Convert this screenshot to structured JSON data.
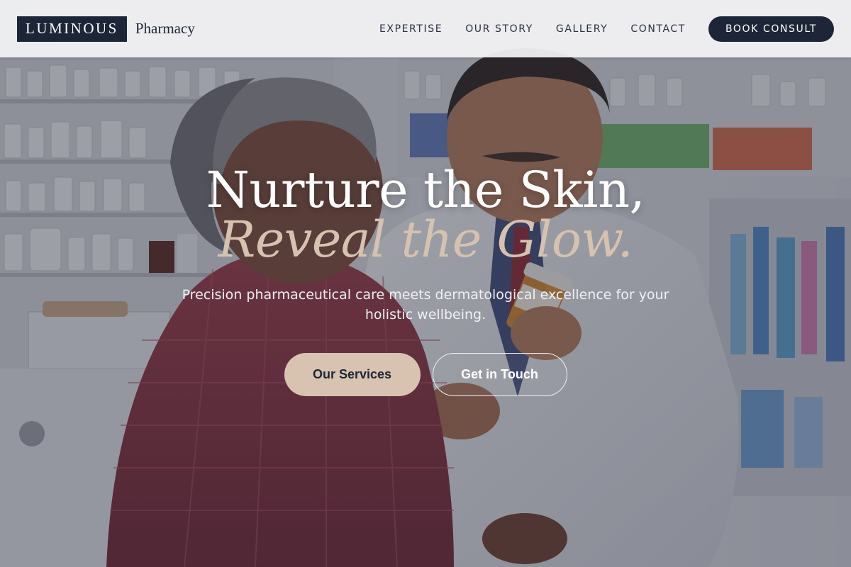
{
  "brand": {
    "logo_text": "LUMINOUS",
    "logo_sub": "Pharmacy"
  },
  "nav": {
    "items": [
      {
        "label": "EXPERTISE"
      },
      {
        "label": "OUR STORY"
      },
      {
        "label": "GALLERY"
      },
      {
        "label": "CONTACT"
      }
    ],
    "cta_label": "BOOK CONSULT"
  },
  "hero": {
    "title_line1": "Nurture the Skin,",
    "title_line2": "Reveal the Glow.",
    "subtitle": "Precision pharmaceutical care meets dermatological excellence for your holistic wellbeing.",
    "primary_button": "Our Services",
    "secondary_button": "Get in Touch"
  },
  "colors": {
    "navy": "#1d2638",
    "accent_beige": "#d8c3b0",
    "header_bg": "#f4f4f6"
  }
}
